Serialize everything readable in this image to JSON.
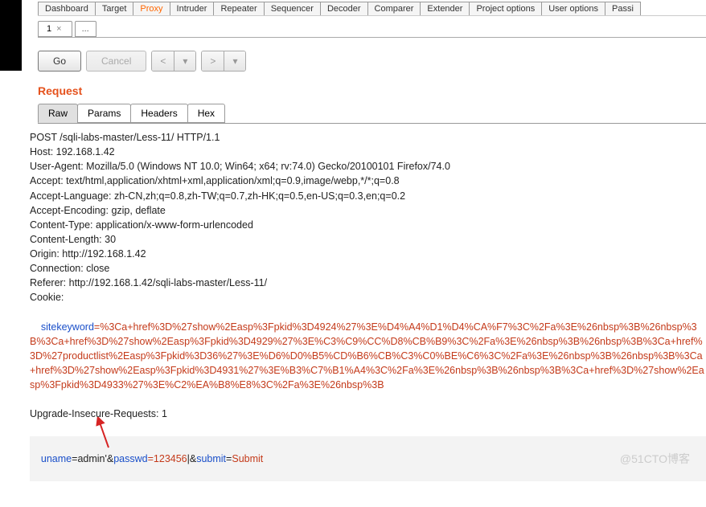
{
  "topTabs": {
    "items": [
      {
        "label": "Dashboard"
      },
      {
        "label": "Target"
      },
      {
        "label": "Proxy",
        "active": true
      },
      {
        "label": "Intruder"
      },
      {
        "label": "Repeater"
      },
      {
        "label": "Sequencer"
      },
      {
        "label": "Decoder"
      },
      {
        "label": "Comparer"
      },
      {
        "label": "Extender"
      },
      {
        "label": "Project options"
      },
      {
        "label": "User options"
      },
      {
        "label": "Passi"
      }
    ]
  },
  "subTab": {
    "label": "1",
    "more": "..."
  },
  "actions": {
    "go": "Go",
    "cancel": "Cancel",
    "prev": "<",
    "prev_dd": "▾",
    "next": ">",
    "next_dd": "▾"
  },
  "section": {
    "request": "Request"
  },
  "reqTabs": {
    "items": [
      {
        "label": "Raw",
        "active": true
      },
      {
        "label": "Params"
      },
      {
        "label": "Headers"
      },
      {
        "label": "Hex"
      }
    ]
  },
  "raw": {
    "lines": [
      "POST /sqli-labs-master/Less-11/ HTTP/1.1",
      "Host: 192.168.1.42",
      "User-Agent: Mozilla/5.0 (Windows NT 10.0; Win64; x64; rv:74.0) Gecko/20100101 Firefox/74.0",
      "Accept: text/html,application/xhtml+xml,application/xml;q=0.9,image/webp,*/*;q=0.8",
      "Accept-Language: zh-CN,zh;q=0.8,zh-TW;q=0.7,zh-HK;q=0.5,en-US;q=0.3,en;q=0.2",
      "Accept-Encoding: gzip, deflate",
      "Content-Type: application/x-www-form-urlencoded",
      "Content-Length: 30",
      "Origin: http://192.168.1.42",
      "Connection: close",
      "Referer: http://192.168.1.42/sqli-labs-master/Less-11/",
      "Cookie:"
    ],
    "cookie_key": "sitekeyword",
    "cookie_val": "=%3Ca+href%3D%27show%2Easp%3Fpkid%3D4924%27%3E%D4%A4%D1%D4%CA%F7%3C%2Fa%3E%26nbsp%3B%26nbsp%3B%3Ca+href%3D%27show%2Easp%3Fpkid%3D4929%27%3E%C3%C9%CC%D8%CB%B9%3C%2Fa%3E%26nbsp%3B%26nbsp%3B%3Ca+href%3D%27productlist%2Easp%3Fpkid%3D36%27%3E%D6%D0%B5%CD%B6%CB%C3%C0%BE%C6%3C%2Fa%3E%26nbsp%3B%26nbsp%3B%3Ca+href%3D%27show%2Easp%3Fpkid%3D4931%27%3E%B3%C7%B1%A4%3C%2Fa%3E%26nbsp%3B%26nbsp%3B%3Ca+href%3D%27show%2Easp%3Fpkid%3D4933%27%3E%C2%EA%B8%E8%3C%2Fa%3E%26nbsp%3B",
    "after": "Upgrade-Insecure-Requests: 1",
    "body": {
      "p1_k": "uname",
      "p1_v": "=admin'&",
      "p2_k": "passwd",
      "p2_v": "=123456",
      "caret": "|",
      "amp": "&",
      "p3_k": "submit",
      "p3_eq": "=",
      "p3_v": "Submit"
    }
  },
  "watermark": "@51CTO博客"
}
